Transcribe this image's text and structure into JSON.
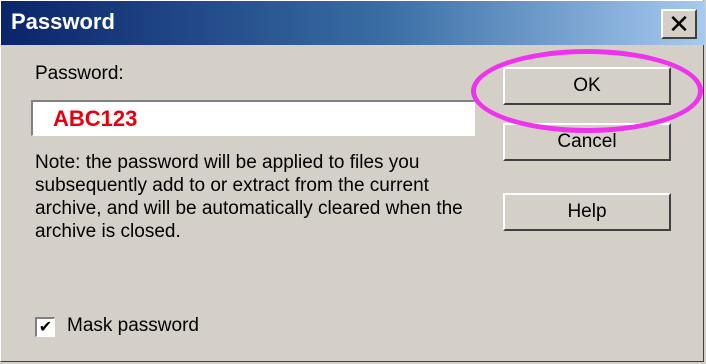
{
  "window": {
    "title": "Password",
    "close_glyph": "✕"
  },
  "form": {
    "password_label": "Password:",
    "password_value": "ABC123",
    "note": "Note:  the password will be applied to files you subsequently add to or extract from the current archive, and will be automatically cleared when the archive is closed.",
    "mask_label": "Mask password",
    "mask_checked": true,
    "check_glyph": "✔"
  },
  "buttons": {
    "ok": "OK",
    "cancel": "Cancel",
    "help": "Help"
  },
  "colors": {
    "title_bar": "#0a246a",
    "dialog_bg": "#d4d0c8",
    "password_text": "#e8000f",
    "highlight_ring": "#ee33ee"
  }
}
